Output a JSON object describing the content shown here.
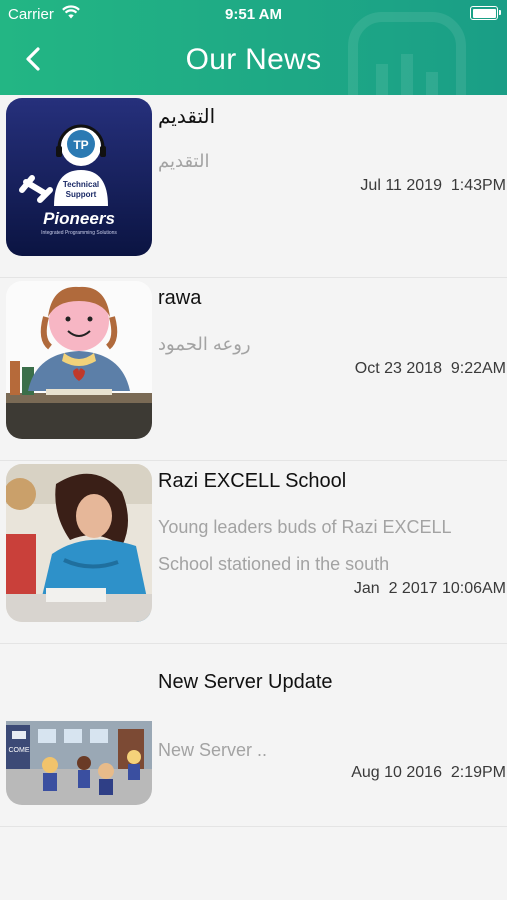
{
  "status_bar": {
    "carrier": "Carrier",
    "time": "9:51 AM",
    "wifi_icon": "wifi-icon",
    "battery_icon": "battery-full-icon"
  },
  "nav": {
    "title": "Our News",
    "back_icon": "chevron-left-icon",
    "colors": {
      "start": "#23b684",
      "end": "#1a9e86"
    }
  },
  "news": [
    {
      "title": "التقديم",
      "summary": "التقديم",
      "date": "Jul 11 2019  1:43PM",
      "thumb_logo": "Pioneers",
      "thumb_badge": "TP",
      "thumb_caption_1": "Technical",
      "thumb_caption_2": "Support",
      "thumb_tagline": "Integrated Programming Solutions"
    },
    {
      "title": "rawa",
      "summary": "روعه الحمود",
      "date": "Oct 23 2018  9:22AM"
    },
    {
      "title": " Razi EXCELL School",
      "summary": "Young leaders buds of Razi EXCELL School stationed in the south",
      "date": "Jan  2 2017 10:06AM"
    },
    {
      "title": "New Server Update",
      "summary": "New Server ..",
      "date": "Aug 10 2016  2:19PM",
      "thumb_sign": "COME"
    }
  ]
}
